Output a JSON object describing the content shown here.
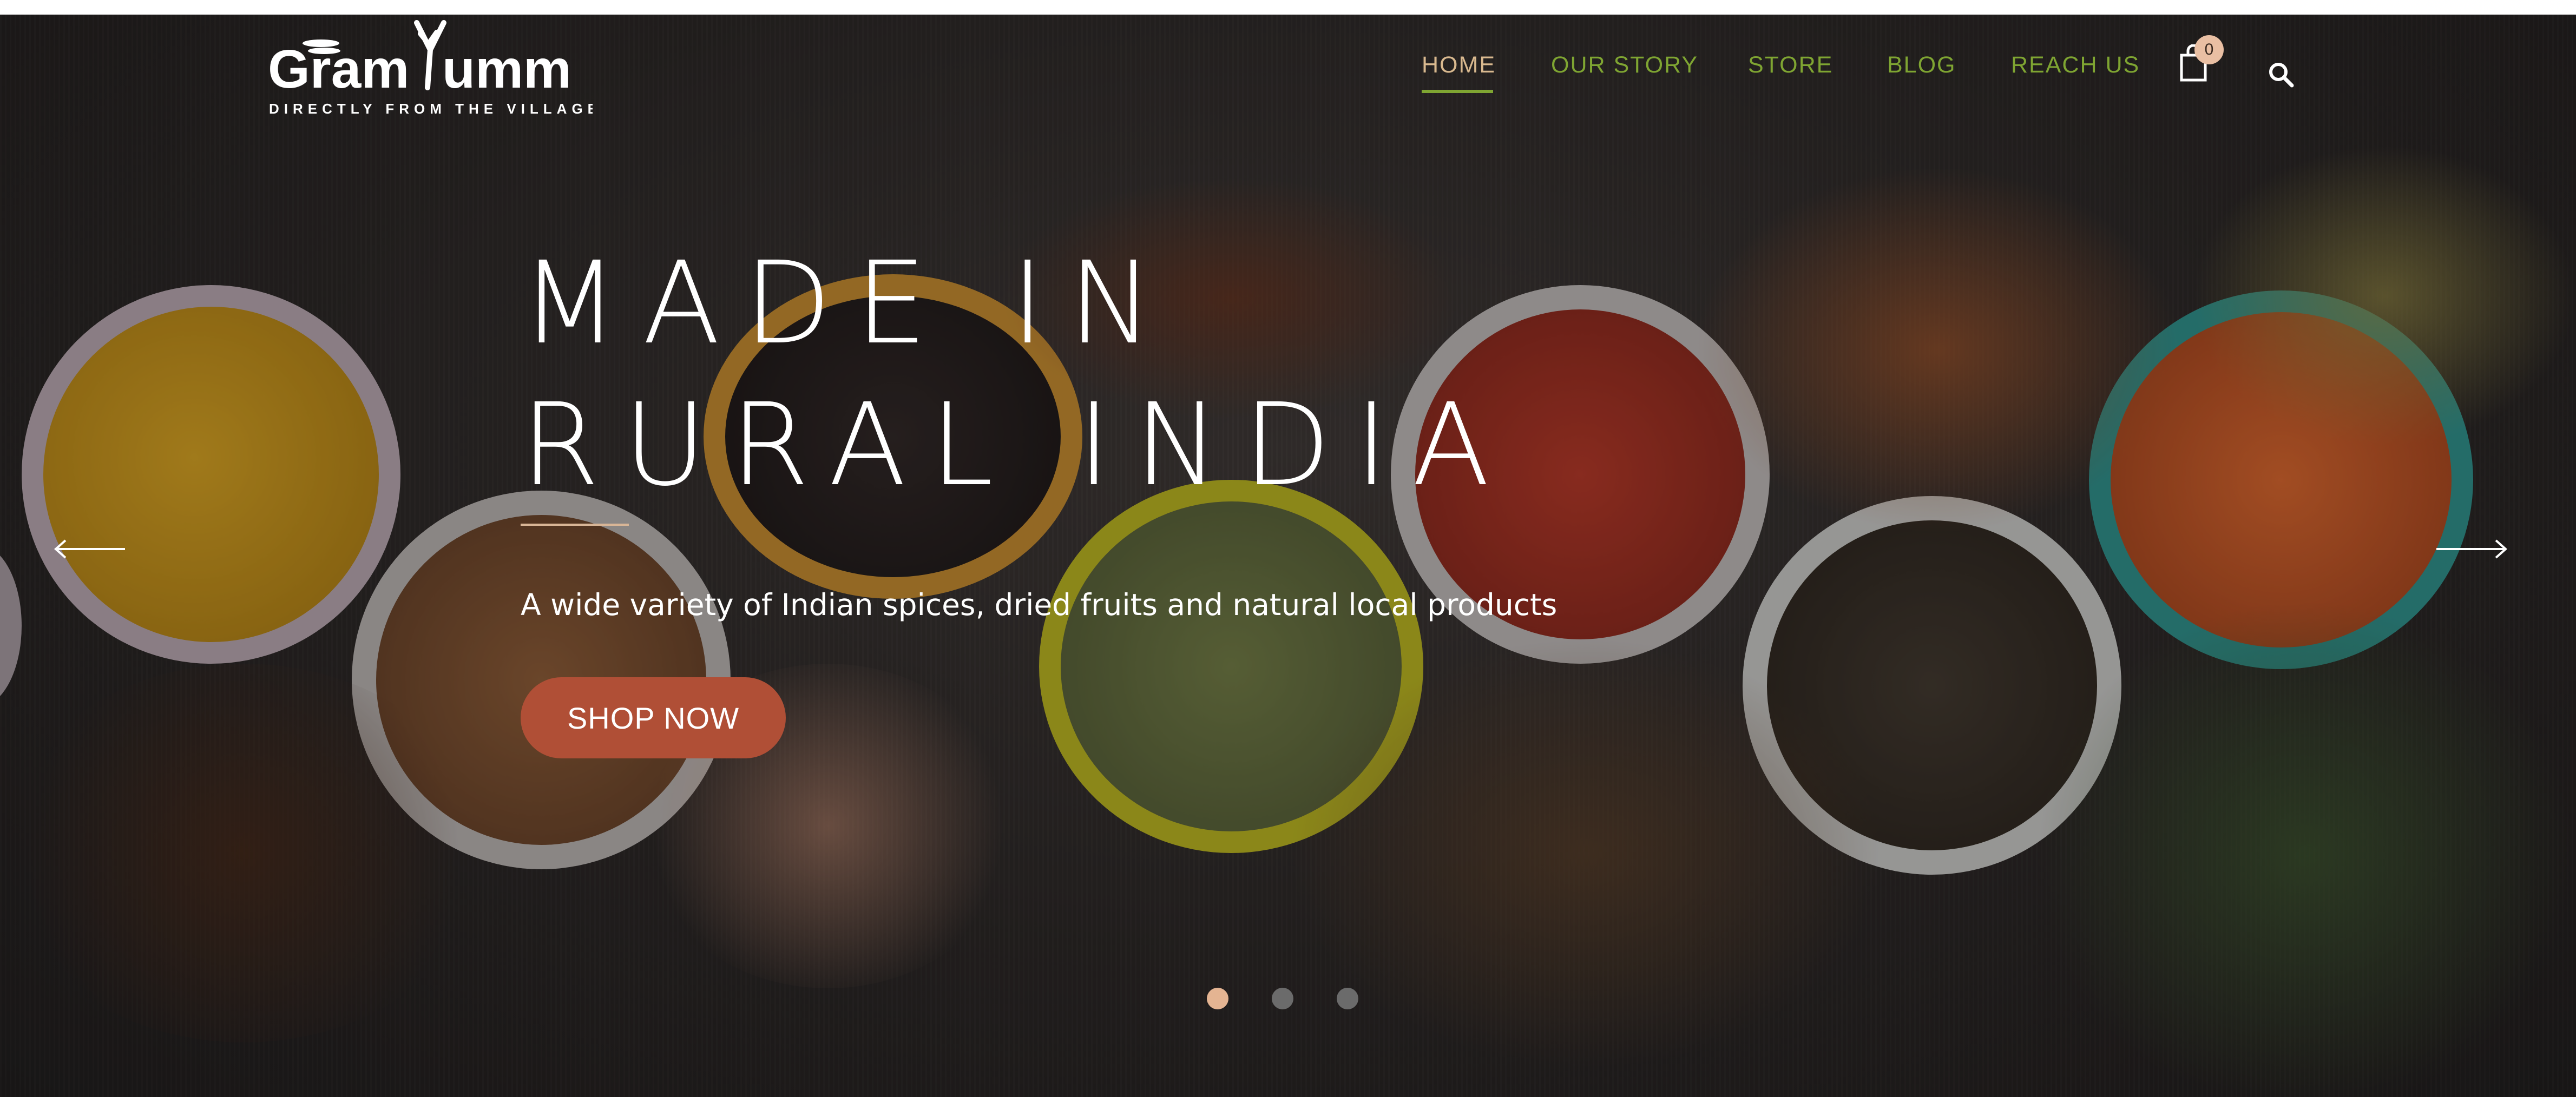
{
  "brand": {
    "name_left": "Gram",
    "name_right": "umm",
    "tagline": "DIRECTLY FROM THE VILLAGE"
  },
  "nav": {
    "items": [
      {
        "label": "HOME",
        "active": true
      },
      {
        "label": "OUR STORY",
        "active": false
      },
      {
        "label": "STORE",
        "active": false
      },
      {
        "label": "BLOG",
        "active": false
      },
      {
        "label": "REACH US",
        "active": false
      }
    ],
    "cart_count": "0",
    "cart_icon": "shopping-bag-icon",
    "search_icon": "search-icon"
  },
  "hero": {
    "headline_line1": "MADE IN",
    "headline_line2": "RURAL INDIA",
    "subtitle": "A wide variety of Indian spices, dried fruits and natural local products",
    "cta_label": "SHOP NOW",
    "prev_icon": "arrow-left-icon",
    "next_icon": "arrow-right-icon",
    "slides_total": 3,
    "active_slide": 1
  },
  "colors": {
    "nav_active": "#d9b98f",
    "nav_default": "#7fa532",
    "cta_bg": "#b04f36",
    "badge_bg": "#e9bfa3"
  }
}
